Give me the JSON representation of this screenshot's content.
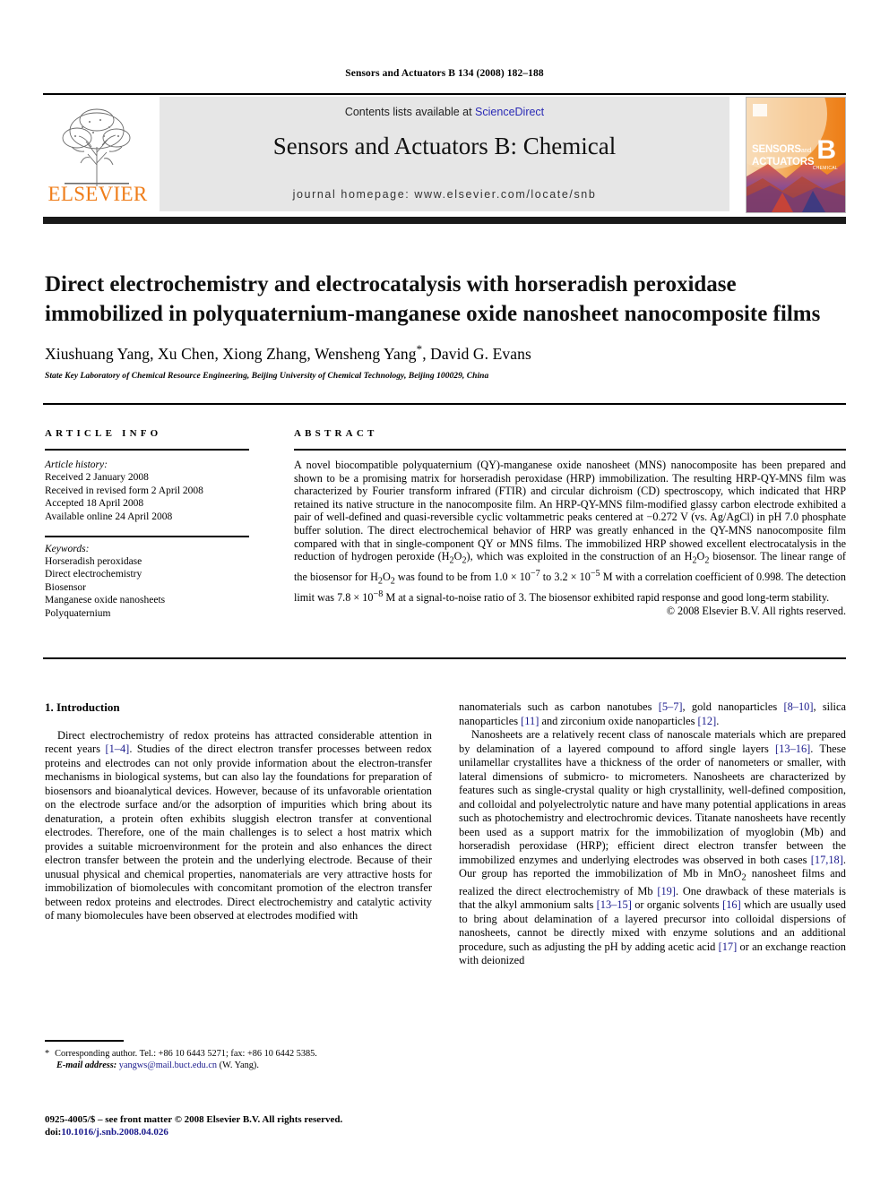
{
  "running_head": "Sensors and Actuators B 134 (2008) 182–188",
  "header": {
    "publisher": "ELSEVIER",
    "contents_prefix": "Contents lists available at ",
    "sciencedirect": "ScienceDirect",
    "journal_title": "Sensors and Actuators B: Chemical",
    "homepage": "journal homepage: www.elsevier.com/locate/snb",
    "cover": {
      "line1": "SENSORS",
      "line1_small": "and",
      "line2": "ACTUATORS",
      "volume_letter": "B",
      "volume_sub": "CHEMICAL"
    }
  },
  "article": {
    "title": "Direct electrochemistry and electrocatalysis with horseradish peroxidase immobilized in polyquaternium-manganese oxide nanosheet nanocomposite films",
    "authors": "Xiushuang Yang, Xu Chen, Xiong Zhang, Wensheng Yang",
    "authors_tail": ", David G. Evans",
    "corresponding_marker": "*",
    "affiliation": "State Key Laboratory of Chemical Resource Engineering, Beijing University of Chemical Technology, Beijing 100029, China"
  },
  "info": {
    "heading": "ARTICLE INFO",
    "history_label": "Article history:",
    "history": [
      "Received 2 January 2008",
      "Received in revised form 2 April 2008",
      "Accepted 18 April 2008",
      "Available online 24 April 2008"
    ],
    "keywords_label": "Keywords:",
    "keywords": [
      "Horseradish peroxidase",
      "Direct electrochemistry",
      "Biosensor",
      "Manganese oxide nanosheets",
      "Polyquaternium"
    ]
  },
  "abstract": {
    "heading": "ABSTRACT",
    "body": "A novel biocompatible polyquaternium (QY)-manganese oxide nanosheet (MNS) nanocomposite has been prepared and shown to be a promising matrix for horseradish peroxidase (HRP) immobilization. The resulting HRP-QY-MNS film was characterized by Fourier transform infrared (FTIR) and circular dichroism (CD) spectroscopy, which indicated that HRP retained its native structure in the nanocomposite film. An HRP-QY-MNS film-modified glassy carbon electrode exhibited a pair of well-defined and quasi-reversible cyclic voltammetric peaks centered at −0.272 V (vs. Ag/AgCl) in pH 7.0 phosphate buffer solution. The direct electrochemical behavior of HRP was greatly enhanced in the QY-MNS nanocomposite film compared with that in single-component QY or MNS films. The immobilized HRP showed excellent electrocatalysis in the reduction of hydrogen peroxide (H2O2), which was exploited in the construction of an H2O2 biosensor. The linear range of the biosensor for H2O2 was found to be from 1.0 × 10−7 to 3.2 × 10−5 M with a correlation coefficient of 0.998. The detection limit was 7.8 × 10−8 M at a signal-to-noise ratio of 3. The biosensor exhibited rapid response and good long-term stability.",
    "copyright": "© 2008 Elsevier B.V. All rights reserved."
  },
  "body": {
    "section_heading": "1. Introduction",
    "left_paragraph": "Direct electrochemistry of redox proteins has attracted considerable attention in recent years [1–4]. Studies of the direct electron transfer processes between redox proteins and electrodes can not only provide information about the electron-transfer mechanisms in biological systems, but can also lay the foundations for preparation of biosensors and bioanalytical devices. However, because of its unfavorable orientation on the electrode surface and/or the adsorption of impurities which bring about its denaturation, a protein often exhibits sluggish electron transfer at conventional electrodes. Therefore, one of the main challenges is to select a host matrix which provides a suitable microenvironment for the protein and also enhances the direct electron transfer between the protein and the underlying electrode. Because of their unusual physical and chemical properties, nanomaterials are very attractive hosts for immobilization of biomolecules with concomitant promotion of the electron transfer between redox proteins and electrodes. Direct electrochemistry and catalytic activity of many biomolecules have been observed at electrodes modified with",
    "right_paragraph_1": "nanomaterials such as carbon nanotubes [5–7], gold nanoparticles [8–10], silica nanoparticles [11] and zirconium oxide nanoparticles [12].",
    "right_paragraph_2": "Nanosheets are a relatively recent class of nanoscale materials which are prepared by delamination of a layered compound to afford single layers [13–16]. These unilamellar crystallites have a thickness of the order of nanometers or smaller, with lateral dimensions of submicro- to micrometers. Nanosheets are characterized by features such as single-crystal quality or high crystallinity, well-defined composition, and colloidal and polyelectrolytic nature and have many potential applications in areas such as photochemistry and electrochromic devices. Titanate nanosheets have recently been used as a support matrix for the immobilization of myoglobin (Mb) and horseradish peroxidase (HRP); efficient direct electron transfer between the immobilized enzymes and underlying electrodes was observed in both cases [17,18]. Our group has reported the immobilization of Mb in MnO2 nanosheet films and realized the direct electrochemistry of Mb [19]. One drawback of these materials is that the alkyl ammonium salts [13–15] or organic solvents [16] which are usually used to bring about delamination of a layered precursor into colloidal dispersions of nanosheets, cannot be directly mixed with enzyme solutions and an additional procedure, such as adjusting the pH by adding acetic acid [17] or an exchange reaction with deionized"
  },
  "footnote": {
    "marker": "*",
    "corresponding": "Corresponding author. Tel.: +86 10 6443 5271; fax: +86 10 6442 5385.",
    "email_label": "E-mail address:",
    "email": "yangws@mail.buct.edu.cn",
    "email_suffix": " (W. Yang)."
  },
  "footer": {
    "issn_line": "0925-4005/$ – see front matter © 2008 Elsevier B.V. All rights reserved.",
    "doi_label": "doi:",
    "doi": "10.1016/j.snb.2008.04.026"
  },
  "colors": {
    "elsevier_orange": "#ef7d1a",
    "link_blue": "#1a1a8c",
    "sciencedirect_blue": "#2a2ab5",
    "band_gray": "#e6e6e6"
  }
}
